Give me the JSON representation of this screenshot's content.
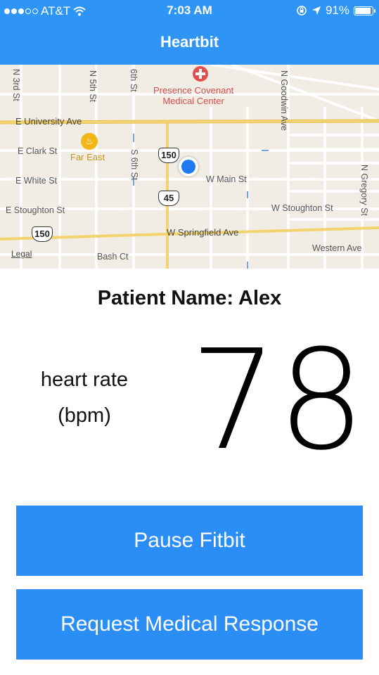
{
  "status_bar": {
    "carrier": "AT&T",
    "time": "7:03 AM",
    "battery": "91%"
  },
  "nav": {
    "title": "Heartbit"
  },
  "map": {
    "streets": {
      "n3rd": "N 3rd St",
      "n5th": "N 5th St",
      "n6th": "6th St",
      "university": "E University Ave",
      "clark": "E Clark St",
      "white": "E White St",
      "stoughton_e": "E Stoughton St",
      "s6th": "S 6th St",
      "wmain": "W Main St",
      "wstoughton": "W Stoughton St",
      "wspringfield": "W Springfield Ave",
      "bash": "Bash Ct",
      "western": "Western Ave",
      "goodwin": "N Goodwin Ave",
      "gregory": "N Gregory St"
    },
    "poi_hospital": "Presence Covenant\nMedical Center",
    "poi_fareast": "Far East",
    "routes": [
      "150",
      "45",
      "150"
    ],
    "legal": "Legal"
  },
  "patient": {
    "label": "Patient Name: Alex"
  },
  "heart_rate": {
    "label_line1": "heart rate",
    "label_line2": "(bpm)",
    "value": "78"
  },
  "buttons": {
    "pause": "Pause Fitbit",
    "request": "Request Medical Response"
  }
}
